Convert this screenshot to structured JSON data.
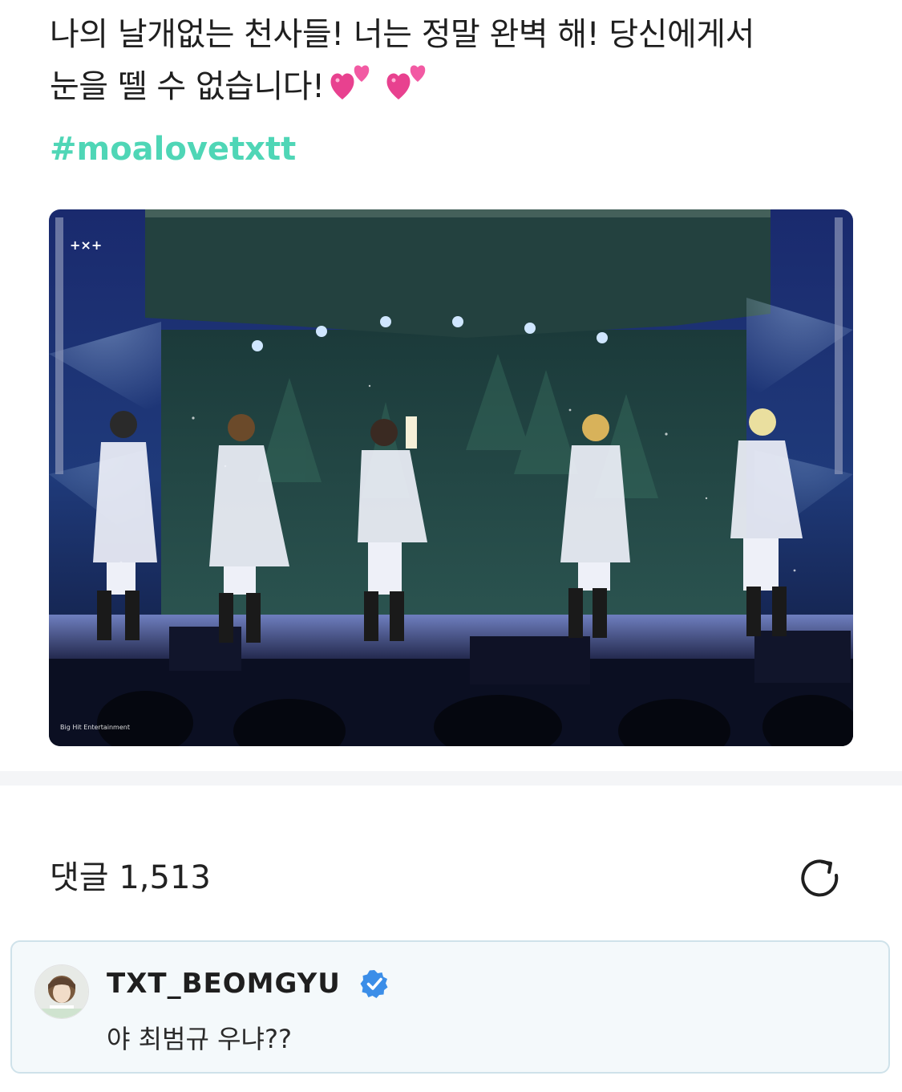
{
  "post": {
    "text_line1": "나의 날개없는 천사들! 너는 정말 완벽 해! 당신에게서",
    "text_line2": "눈을 뗄 수 없습니다!",
    "emoji": [
      "two-hearts-icon",
      "two-hearts-icon"
    ],
    "hashtag": "#moalovetxtt",
    "image": {
      "subject": "concert-stage-photo",
      "watermark_logo": "+×+",
      "watermark_credit": "Big Hit Entertainment"
    }
  },
  "comments": {
    "label": "댓글",
    "count": "1,513",
    "refresh_icon": "refresh-icon"
  },
  "featured_comment": {
    "username": "TXT_BEOMGYU",
    "verified_icon": "verified-badge-icon",
    "text": "야 최범규 우냐??"
  },
  "colors": {
    "hashtag": "#4fd6b6",
    "verified": "#3b8ee8",
    "card_border": "#cfe2ea",
    "divider": "#f4f5f7"
  }
}
